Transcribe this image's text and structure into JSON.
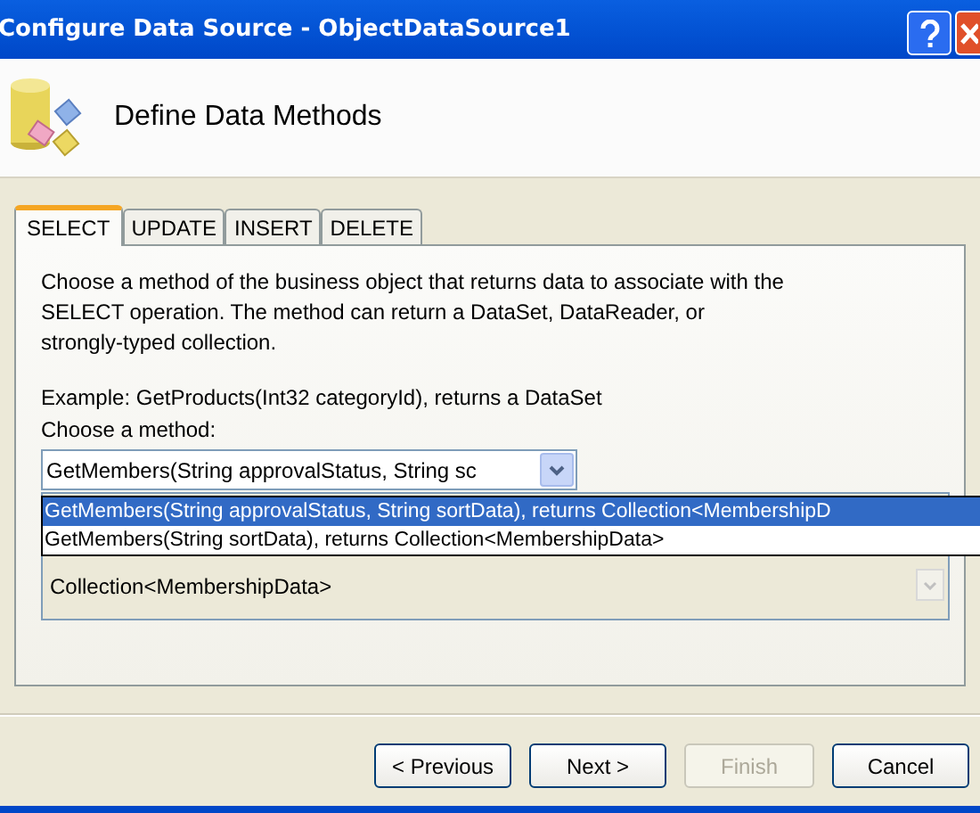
{
  "window": {
    "title": "Configure Data Source - ObjectDataSource1"
  },
  "header": {
    "title": "Define Data Methods"
  },
  "tabs": [
    {
      "label": "SELECT",
      "selected": true
    },
    {
      "label": "UPDATE",
      "selected": false
    },
    {
      "label": "INSERT",
      "selected": false
    },
    {
      "label": "DELETE",
      "selected": false
    }
  ],
  "description": "Choose a method of the business object that returns data to associate with the SELECT operation. The method can return a DataSet, DataReader, or strongly-typed collection.",
  "example": "Example: GetProducts(Int32 categoryId), returns a DataSet",
  "method_label": "Choose a method:",
  "method_combo": {
    "value": "GetMembers(String approvalStatus, String sc",
    "expanded": true
  },
  "method_options": [
    {
      "label": "GetMembers(String approvalStatus, String sortData), returns Collection<MembershipD",
      "selected": true
    },
    {
      "label": "GetMembers(String sortData), returns Collection<MembershipData>",
      "selected": false
    }
  ],
  "signature_box": {
    "text": "Collection<MembershipData>"
  },
  "buttons": [
    {
      "label": "< Previous",
      "disabled": false
    },
    {
      "label": "Next >",
      "disabled": false
    },
    {
      "label": "Finish",
      "disabled": true
    },
    {
      "label": "Cancel",
      "disabled": false
    }
  ]
}
